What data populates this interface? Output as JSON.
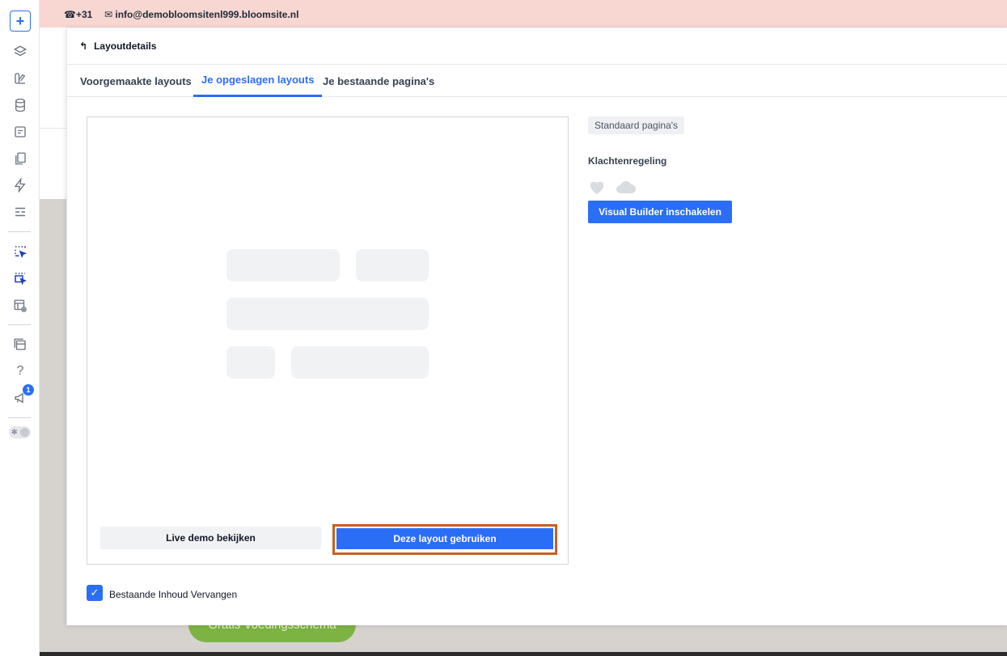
{
  "site": {
    "phone": "+31",
    "email": "info@demobloomsitenl999.bloomsite.nl",
    "green_button": "Gratis Voedingsschema"
  },
  "toolbar": {
    "add_label": "+",
    "help_label": "?",
    "notification_count": "1",
    "toggle_sun": "✻"
  },
  "panel": {
    "back_icon": "↰",
    "title": "Layoutdetails",
    "tabs": [
      {
        "label": "Voorgemaakte layouts"
      },
      {
        "label": "Je opgeslagen layouts"
      },
      {
        "label": "Je bestaande pagina's"
      }
    ],
    "preview": {
      "demo_button": "Live demo bekijken",
      "use_button": "Deze layout gebruiken"
    },
    "replace_checkbox": {
      "checked": true,
      "mark": "✓",
      "label": "Bestaande Inhoud Vervangen"
    },
    "info": {
      "category_chip": "Standaard pagina's",
      "layout_name": "Klachtenregeling",
      "visual_builder_button": "Visual Builder inschakelen"
    }
  },
  "colors": {
    "accent": "#2b6ef6",
    "highlight_border": "#c8601d",
    "topbar_bg": "#f8d7d2"
  }
}
